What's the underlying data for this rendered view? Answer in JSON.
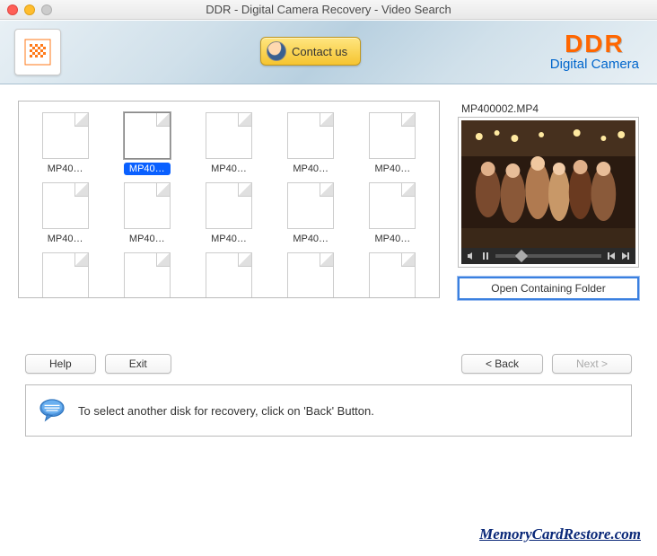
{
  "window": {
    "title": "DDR - Digital Camera Recovery - Video Search"
  },
  "header": {
    "contact_label": "Contact us",
    "brand": "DDR",
    "brand_sub": "Digital Camera"
  },
  "files": {
    "items": [
      {
        "label": "MP40…",
        "selected": false
      },
      {
        "label": "MP40…",
        "selected": true
      },
      {
        "label": "MP40…",
        "selected": false
      },
      {
        "label": "MP40…",
        "selected": false
      },
      {
        "label": "MP40…",
        "selected": false
      },
      {
        "label": "MP40…",
        "selected": false
      },
      {
        "label": "MP40…",
        "selected": false
      },
      {
        "label": "MP40…",
        "selected": false
      },
      {
        "label": "MP40…",
        "selected": false
      },
      {
        "label": "MP40…",
        "selected": false
      },
      {
        "label": "",
        "selected": false
      },
      {
        "label": "",
        "selected": false
      },
      {
        "label": "",
        "selected": false
      },
      {
        "label": "",
        "selected": false
      },
      {
        "label": "",
        "selected": false
      }
    ]
  },
  "preview": {
    "filename": "MP400002.MP4",
    "open_folder_label": "Open Containing Folder"
  },
  "buttons": {
    "help": "Help",
    "exit": "Exit",
    "back": "< Back",
    "next": "Next >"
  },
  "hint": {
    "text": "To select another disk for recovery, click on 'Back' Button."
  },
  "watermark": "MemoryCardRestore.com"
}
